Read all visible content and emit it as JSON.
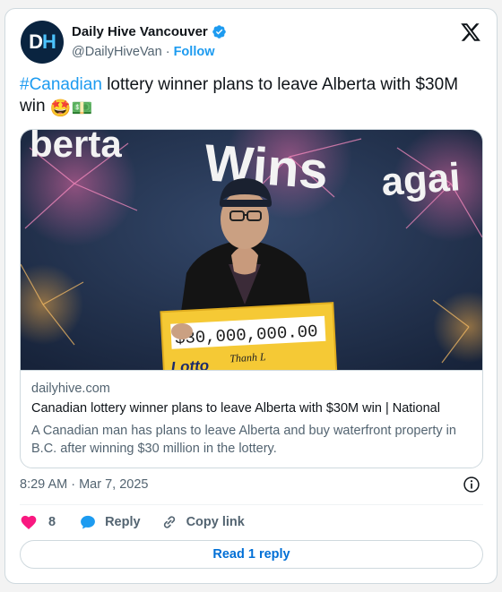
{
  "author": {
    "display_name": "Daily Hive Vancouver",
    "handle": "@DailyHiveVan",
    "separator": " · ",
    "follow_label": "Follow",
    "avatar_text_d": "D",
    "avatar_text_h": "H"
  },
  "tweet": {
    "hashtag": "#Canadian",
    "text": " lottery winner plans to leave Alberta with $30M win ",
    "emoji_1": "🤩",
    "emoji_2": "💵"
  },
  "link_card": {
    "photo_words": {
      "left": "berta",
      "center": "Wins",
      "right": "agai"
    },
    "cheque": {
      "amount": "$30,000,000.00",
      "name": "Thanh L",
      "brand": "Lotto"
    },
    "domain": "dailyhive.com",
    "title": "Canadian lottery winner plans to leave Alberta with $30M win | National",
    "description": "A Canadian man has plans to leave Alberta and buy waterfront property in B.C. after winning $30 million in the lottery."
  },
  "timestamp": "8:29 AM · Mar 7, 2025",
  "actions": {
    "like_count": "8",
    "reply_label": "Reply",
    "copy_link_label": "Copy link"
  },
  "read_reply_label": "Read 1 reply",
  "colors": {
    "accent": "#1d9bf0",
    "like": "#f91880",
    "background_wall": "#23344d",
    "cheque": "#f5c935"
  }
}
